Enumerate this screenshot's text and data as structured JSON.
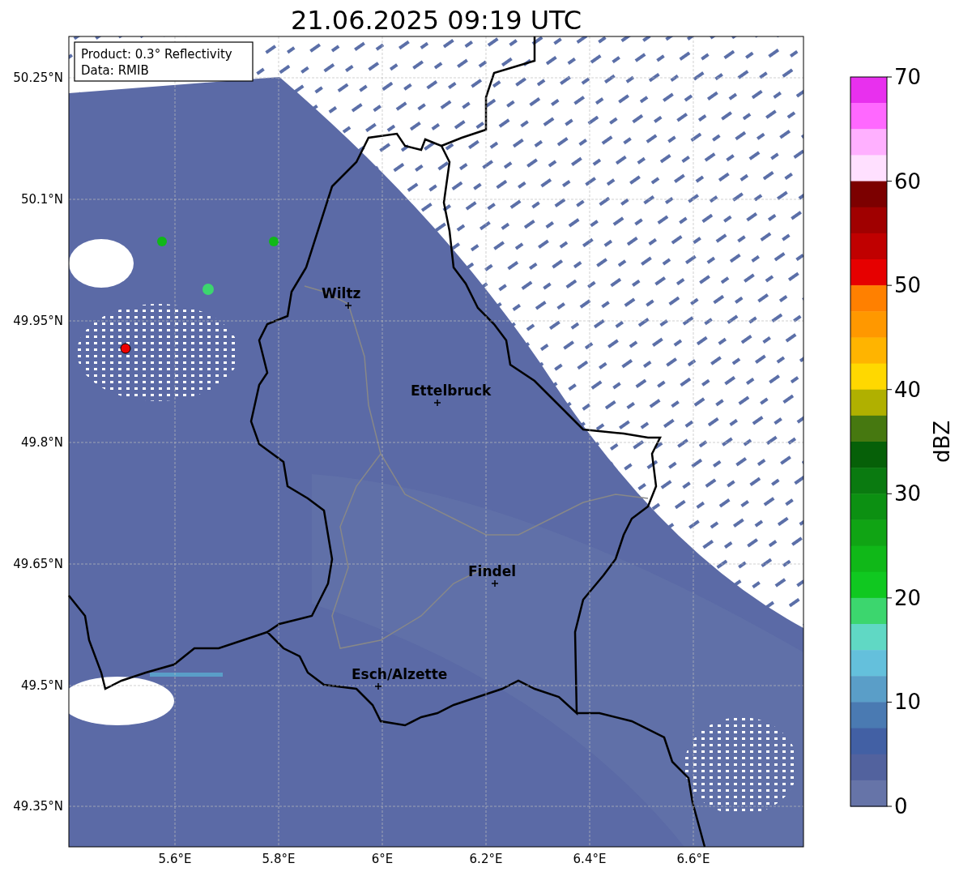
{
  "title": "21.06.2025 09:19 UTC",
  "info_box": [
    "Product: 0.3° Reflectivity",
    "Data: RMIB"
  ],
  "map": {
    "x_tick_labels": [
      "5.6°E",
      "5.8°E",
      "6°E",
      "6.2°E",
      "6.4°E",
      "6.6°E"
    ],
    "y_tick_labels": [
      "50.25°N",
      "50.1°N",
      "49.95°N",
      "49.8°N",
      "49.65°N",
      "49.5°N",
      "49.35°N"
    ],
    "cities": [
      "Wiltz",
      "Ettelbruck",
      "Findel",
      "Esch/Alzette"
    ]
  },
  "colorbar": {
    "label": "dBZ",
    "ticks": [
      "70",
      "60",
      "50",
      "40",
      "30",
      "20",
      "10",
      "0"
    ]
  }
}
